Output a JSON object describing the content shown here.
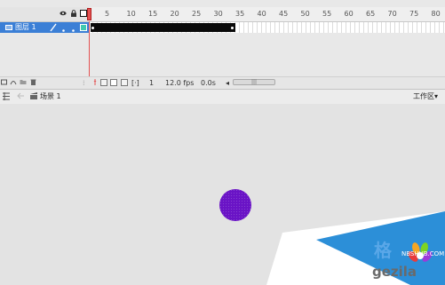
{
  "timeline": {
    "ruler_numbers": [
      "5",
      "10",
      "15",
      "20",
      "25",
      "30",
      "35",
      "40",
      "45",
      "50",
      "55",
      "60",
      "65",
      "70",
      "75",
      "80"
    ],
    "layer": {
      "name": "图层 1"
    }
  },
  "status": {
    "current_frame": "1",
    "frame_rate": "12.0 fps",
    "elapsed_time": "0.0s"
  },
  "edit_bar": {
    "scene_name": "场景 1",
    "workspace_label": "工作区▾"
  },
  "watermark": {
    "brand_cn": "格",
    "brand_en": "gezila",
    "url": "NBSHUB.COM"
  },
  "colors": {
    "selected_layer": "#3b7fd6",
    "playhead": "#e45252",
    "circle_fill": "#6a13c6",
    "watermark_blue": "#2c8fd8"
  }
}
